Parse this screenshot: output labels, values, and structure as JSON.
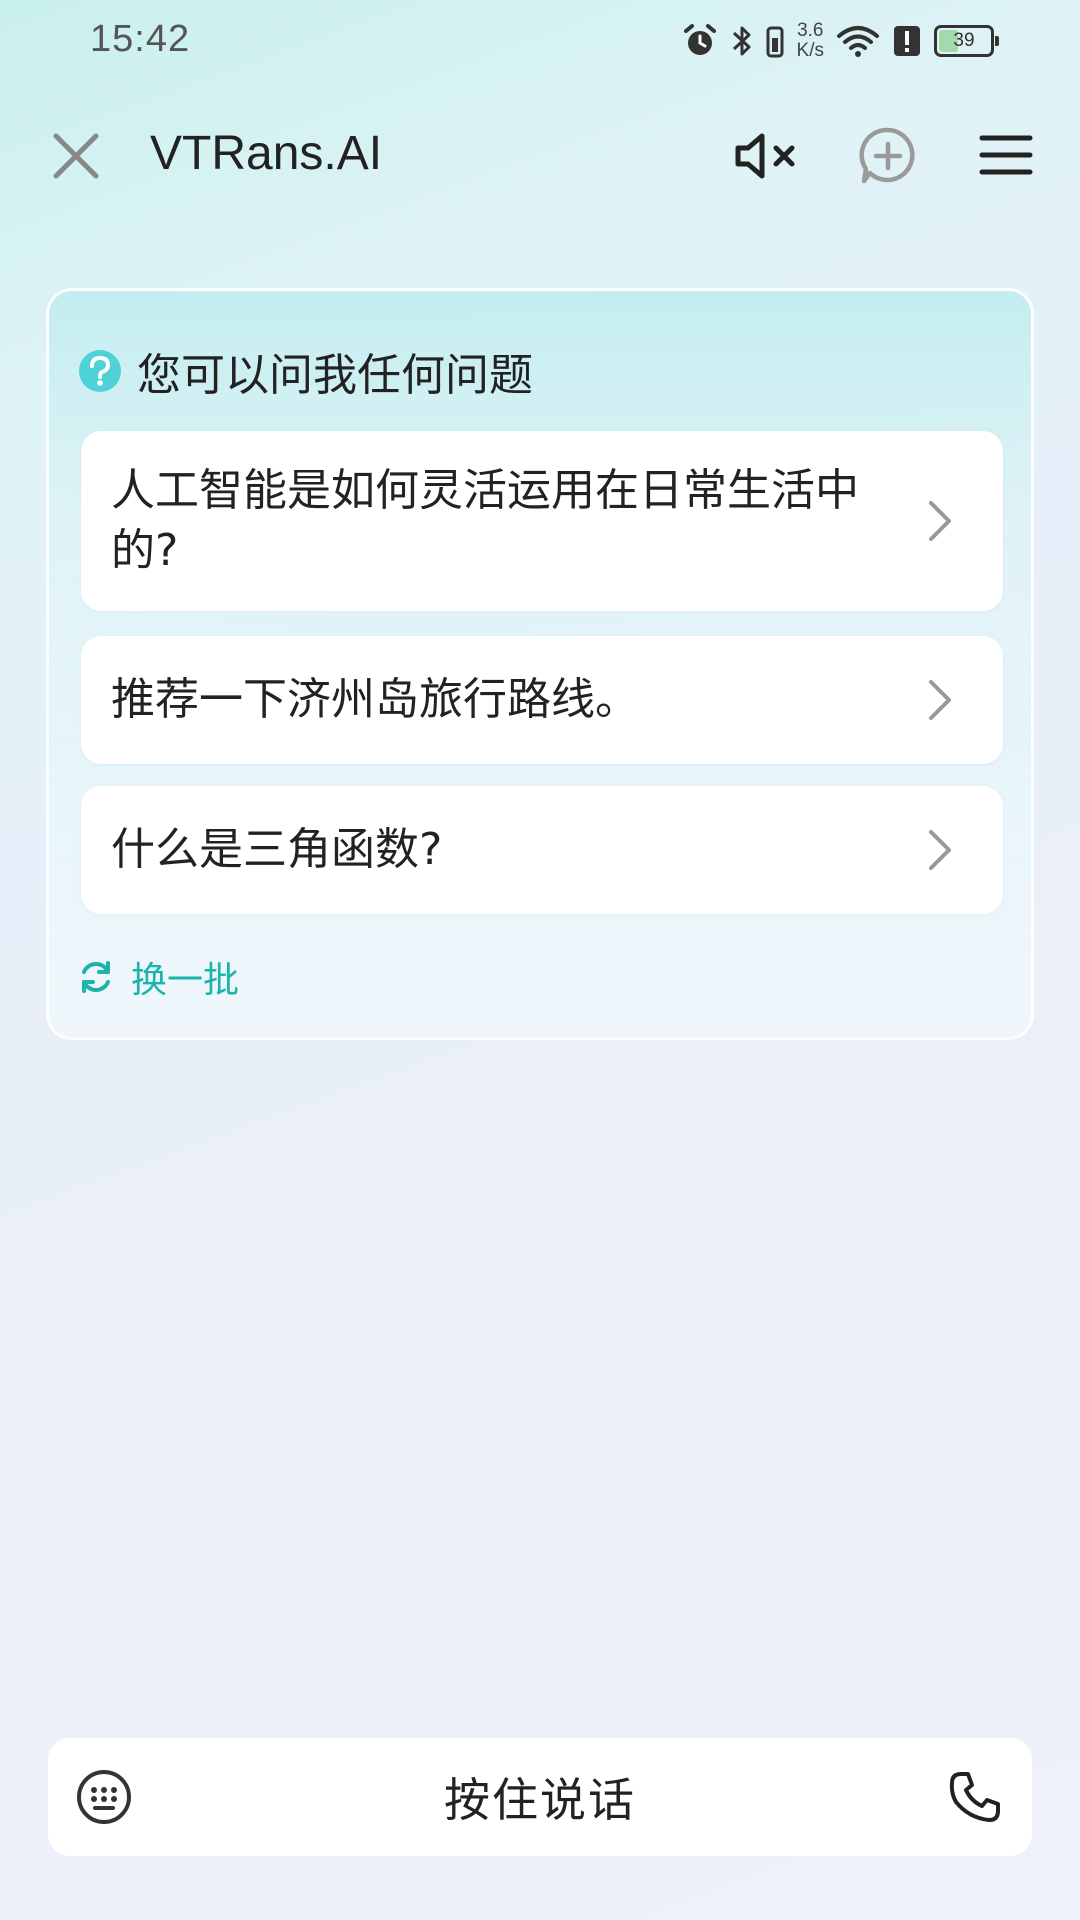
{
  "status_bar": {
    "time": "15:42",
    "net_speed_value": "3.6",
    "net_speed_unit": "K/s",
    "battery_level": "39",
    "icons": [
      "alarm-icon",
      "bluetooth-icon",
      "vibrate-icon",
      "wifi-icon",
      "alert-icon",
      "battery-icon"
    ]
  },
  "header": {
    "title": "VTRans.AI",
    "icons": [
      "close-icon",
      "speaker-mute-icon",
      "chat-plus-icon",
      "menu-icon"
    ]
  },
  "suggestions": {
    "heading": "您可以问我任何问题",
    "questions": [
      "人工智能是如何灵活运用在日常生活中的?",
      "推荐一下济州岛旅行路线。",
      "什么是三角函数?"
    ],
    "refresh_label": "换一批"
  },
  "input_bar": {
    "hold_to_talk_label": "按住说话",
    "icons": [
      "keyboard-icon",
      "phone-icon"
    ]
  },
  "colors": {
    "accent": "#1db3ad",
    "help_icon": "#4fd1d9",
    "card_bg": "#ffffff"
  }
}
